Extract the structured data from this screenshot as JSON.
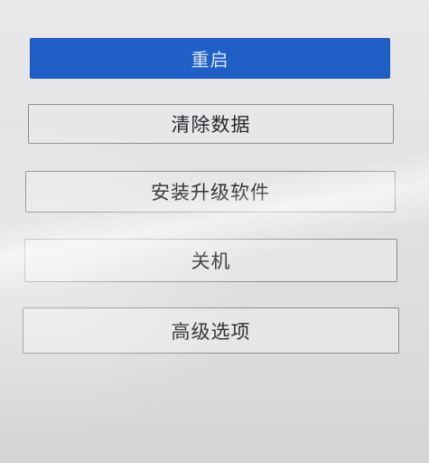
{
  "menu": {
    "items": [
      {
        "label": "重启",
        "selected": true
      },
      {
        "label": "清除数据",
        "selected": false
      },
      {
        "label": "安装升级软件",
        "selected": false
      },
      {
        "label": "关机",
        "selected": false
      },
      {
        "label": "高级选项",
        "selected": false
      }
    ]
  },
  "colors": {
    "selected_background": "#1f5fc6",
    "button_border": "#8d8c90",
    "screen_background": "#e4e3e5"
  }
}
